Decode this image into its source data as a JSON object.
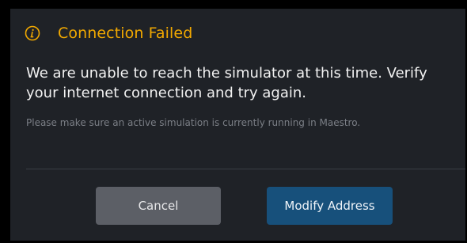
{
  "dialog": {
    "title": "Connection Failed",
    "icon": "info-icon",
    "message": "We are unable to reach the simulator at this time. Verify your internet connection and try again.",
    "note": "Please make sure an active simulation is currently running in Maestro.",
    "buttons": {
      "cancel_label": "Cancel",
      "modify_label": "Modify Address"
    }
  },
  "colors": {
    "accent": "#f2a900",
    "background": "#1f2227",
    "cancel_button": "#5c5f66",
    "primary_button": "#17507b"
  }
}
